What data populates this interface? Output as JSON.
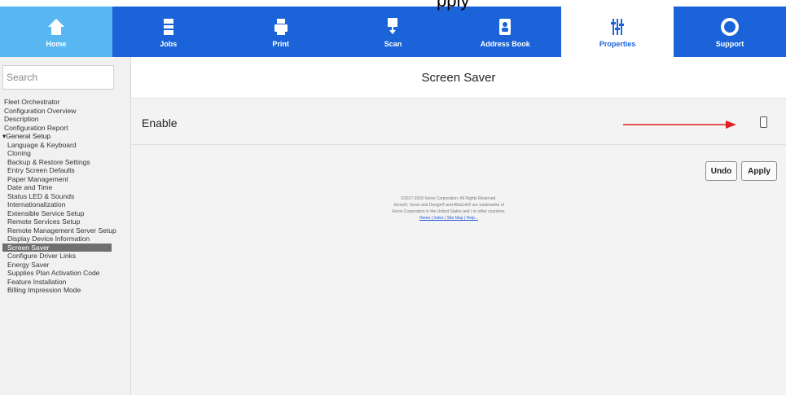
{
  "caption_partial": "pply",
  "nav": {
    "items": [
      {
        "label": "Home",
        "icon": "home-icon"
      },
      {
        "label": "Jobs",
        "icon": "jobs-icon"
      },
      {
        "label": "Print",
        "icon": "printer-icon"
      },
      {
        "label": "Scan",
        "icon": "scan-icon"
      },
      {
        "label": "Address Book",
        "icon": "address-book-icon"
      },
      {
        "label": "Properties",
        "icon": "properties-icon"
      },
      {
        "label": "Support",
        "icon": "support-icon"
      }
    ],
    "colors": {
      "primary": "#1a63d8",
      "home": "#58b6f0",
      "active_bg": "#ffffff"
    }
  },
  "sidebar": {
    "search_placeholder": "Search",
    "items": [
      "Fleet Orchestrator",
      "Configuration Overview",
      "Description",
      "Configuration Report",
      "▾General Setup",
      "Language & Keyboard",
      "Cloning",
      "Backup & Restore Settings",
      "Entry Screen Defaults",
      "Paper Management",
      "Date and Time",
      "Status LED & Sounds",
      "Internationalization",
      "Extensible Service Setup",
      "Remote Services Setup",
      "Remote Management Server Setup",
      "Display Device Information",
      "Screen Saver",
      "Configure Driver Links",
      "Energy Saver",
      "Supplies Plan Activation Code",
      "Feature Installation",
      "Billing Impression Mode"
    ],
    "active_index": 17
  },
  "main": {
    "title": "Screen Saver",
    "enable_label": "Enable",
    "undo_label": "Undo",
    "apply_label": "Apply",
    "footer_lines": [
      "©2017-2019 Xerox Corporation. All Rights Reserved.",
      "Xerox®, Xerox and Design® and AltaLink® are trademarks of",
      "Xerox Corporation in the United States and / or other countries."
    ],
    "footer_links": "Home | Index | Site Map | Help...",
    "arrow_color": "#e02020"
  }
}
